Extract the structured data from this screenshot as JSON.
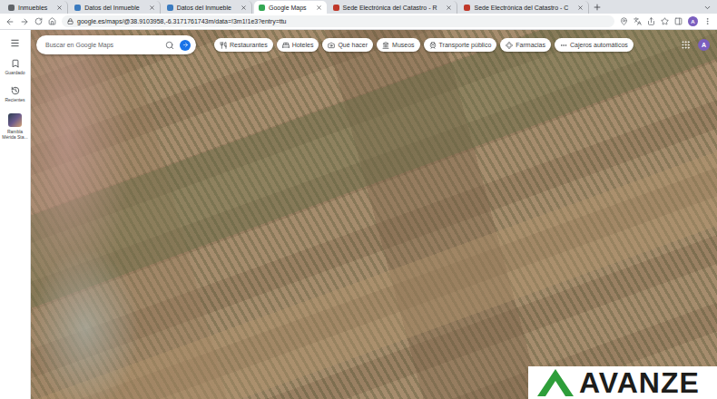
{
  "tabs": [
    {
      "label": "Inmuebles",
      "selected": false,
      "color": "#5f6368"
    },
    {
      "label": "Datos del Inmueble",
      "selected": false,
      "color": "#3b7bbf"
    },
    {
      "label": "Datos del Inmueble",
      "selected": false,
      "color": "#3b7bbf"
    },
    {
      "label": "Google Maps",
      "selected": true,
      "color": "#34a853"
    },
    {
      "label": "Sede Electrónica del Catastro - R",
      "selected": false,
      "color": "#c0392b"
    },
    {
      "label": "Sede Electrónica del Catastro - C",
      "selected": false,
      "color": "#c0392b"
    }
  ],
  "address_bar": {
    "url": "google.es/maps/@38.9103958,-6.3171761743m/data=!3m1!1e3?entry=ttu"
  },
  "browser_profile": "A",
  "sidebar": {
    "items": [
      {
        "label": "Guardado",
        "kind": "saved"
      },
      {
        "label": "Recientes",
        "kind": "recent"
      },
      {
        "label": "Rambla Mérida Sta...",
        "kind": "place"
      }
    ]
  },
  "search": {
    "placeholder": "Buscar en Google Maps"
  },
  "chips": [
    {
      "label": "Restaurantes",
      "kind": "restaurants"
    },
    {
      "label": "Hoteles",
      "kind": "hotels"
    },
    {
      "label": "Qué hacer",
      "kind": "todo"
    },
    {
      "label": "Museos",
      "kind": "museums"
    },
    {
      "label": "Transporte público",
      "kind": "transit"
    },
    {
      "label": "Farmacias",
      "kind": "pharmacy"
    },
    {
      "label": "Cajeros automáticos",
      "kind": "atm"
    }
  ],
  "maps_profile": "A",
  "watermark": {
    "text": "AVANZE"
  }
}
